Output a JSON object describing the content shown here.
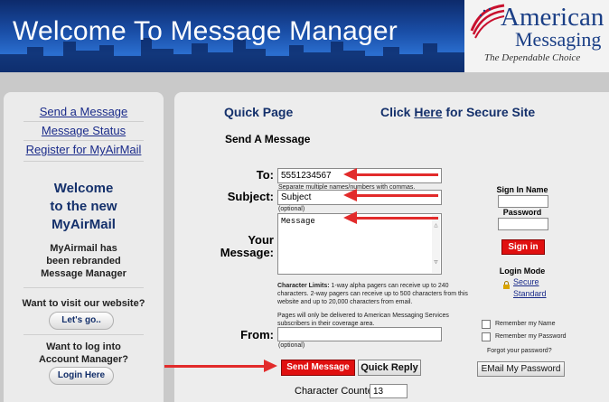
{
  "header": {
    "title": "Welcome To Message Manager",
    "logo": {
      "line1": "American",
      "line2": "Messaging",
      "tagline": "The Dependable Choice"
    }
  },
  "sidebar": {
    "links": [
      "Send a Message",
      "Message Status",
      "Register for MyAirMail"
    ],
    "welcome_lines": [
      "Welcome",
      "to the new",
      "MyAirMail"
    ],
    "rebrand_lines": [
      "MyAirmail has",
      "been rebranded",
      "Message Manager"
    ],
    "visit_question": "Want to visit our website?",
    "visit_button": "Let's go..",
    "login_question_lines": [
      "Want to log into",
      "Account Manager?"
    ],
    "login_button": "Login Here"
  },
  "main": {
    "quick_page": "Quick Page",
    "secure_site": {
      "prefix": "Click ",
      "link": "Here",
      "suffix": " for Secure Site"
    },
    "form_title": "Send A Message",
    "to_label": "To:",
    "to_value": "5551234567",
    "to_hint": "Separate multiple names/numbers with commas.",
    "subject_label": "Subject:",
    "subject_value": "Subject",
    "subject_hint": "(optional)",
    "message_label_lines": [
      "Your",
      "Message:"
    ],
    "message_value": "Message",
    "char_limits_bold": "Character Limits:",
    "char_limits_text": " 1-way alpha pagers can receive up to 240 characters. 2-way pagers can receive up to 500 characters from this website and up to 20,000 characters from email.",
    "delivery_note": "Pages will only be delivered to American Messaging Services subscribers in their coverage area.",
    "from_label": "From:",
    "from_value": "",
    "from_hint": "(optional)",
    "send_button": "Send Message",
    "quick_reply_button": "Quick Reply",
    "counter_label": "Character Counter",
    "counter_value": "13"
  },
  "signin": {
    "name_label": "Sign In Name",
    "password_label": "Password",
    "button": "Sign in",
    "login_mode_label": "Login Mode",
    "secure_label": "Secure",
    "standard_label": "Standard",
    "remember_name": "Remember my Name",
    "remember_password": "Remember my Password",
    "forgot_password": "Forgot your password?",
    "email_password_button": "EMail My Password"
  },
  "colors": {
    "accent_blue": "#14306b",
    "annotation_red": "#e22b2b",
    "button_red": "#e01010"
  }
}
